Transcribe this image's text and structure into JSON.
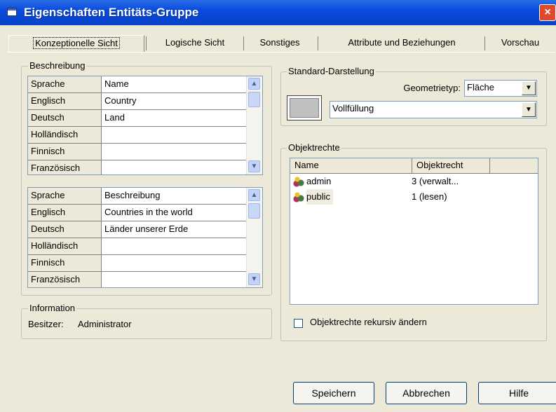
{
  "window": {
    "title": "Eigenschaften Entitäts-Gruppe",
    "close": "×"
  },
  "tabs": [
    "Konzeptionelle Sicht",
    "Logische Sicht",
    "Sonstiges",
    "Attribute und Beziehungen",
    "Vorschau"
  ],
  "beschreibung": {
    "legend": "Beschreibung",
    "name_grid": {
      "headers": [
        "Sprache",
        "Name"
      ],
      "rows": [
        [
          "Englisch",
          "Country"
        ],
        [
          "Deutsch",
          "Land"
        ],
        [
          "Holländisch",
          ""
        ],
        [
          "Finnisch",
          ""
        ],
        [
          "Französisch",
          ""
        ]
      ]
    },
    "desc_grid": {
      "headers": [
        "Sprache",
        "Beschreibung"
      ],
      "rows": [
        [
          "Englisch",
          "Countries in the world"
        ],
        [
          "Deutsch",
          "Länder unserer Erde"
        ],
        [
          "Holländisch",
          ""
        ],
        [
          "Finnisch",
          ""
        ],
        [
          "Französisch",
          ""
        ]
      ]
    }
  },
  "information": {
    "legend": "Information",
    "owner_label": "Besitzer:",
    "owner_value": "Administrator"
  },
  "standard_darstellung": {
    "legend": "Standard-Darstellung",
    "geometrietyp_label": "Geometrietyp:",
    "geometrietyp_value": "Fläche",
    "fill_value": "Vollfüllung",
    "swatch_color": "#c0c0c0"
  },
  "objektrechte": {
    "legend": "Objektrechte",
    "headers": [
      "Name",
      "Objektrecht"
    ],
    "rows": [
      {
        "name": "admin",
        "right": "3 (verwalt..."
      },
      {
        "name": "public",
        "right": "1 (lesen)"
      }
    ],
    "recursive_label": "Objektrechte rekursiv ändern",
    "recursive_checked": false
  },
  "buttons": {
    "save": "Speichern",
    "cancel": "Abbrechen",
    "help": "Hilfe"
  }
}
